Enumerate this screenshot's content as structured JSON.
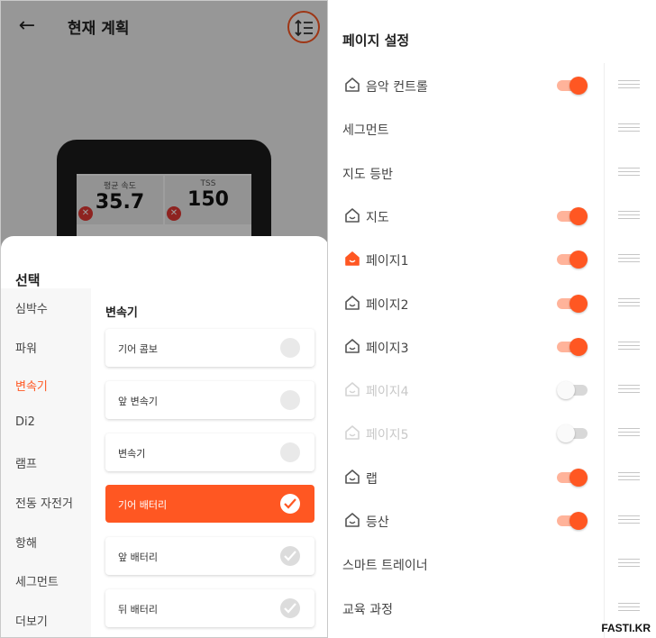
{
  "left": {
    "back_icon": "arrow-left-icon",
    "title": "현재 계획",
    "reorder_icon": "reorder-list-icon",
    "device_metrics": [
      {
        "label": "평균 속도",
        "value": "35.7"
      },
      {
        "label": "TSS",
        "value": "150"
      }
    ],
    "sheet": {
      "title": "선택",
      "categories": [
        "심박수",
        "파워",
        "변속기",
        "Di2",
        "램프",
        "전동 자전거",
        "항해",
        "세그먼트",
        "더보기"
      ],
      "active_category": "변속기",
      "section_title": "변속기",
      "options": [
        {
          "label": "기어 콤보",
          "state": "unchecked"
        },
        {
          "label": "앞 변속기",
          "state": "unchecked"
        },
        {
          "label": "변속기",
          "state": "unchecked"
        },
        {
          "label": "기어 배터리",
          "state": "selected"
        },
        {
          "label": "앞 배터리",
          "state": "checked"
        },
        {
          "label": "뒤 배터리",
          "state": "checked"
        }
      ]
    }
  },
  "right": {
    "title": "페이지 설정",
    "rows": [
      {
        "label": "음악 컨트롤",
        "icon": "home-outline-icon",
        "toggle": "on"
      },
      {
        "label": "세그먼트",
        "icon": "",
        "toggle": "none"
      },
      {
        "label": "지도 등반",
        "icon": "",
        "toggle": "none"
      },
      {
        "label": "지도",
        "icon": "home-outline-icon",
        "toggle": "on"
      },
      {
        "label": "페이지1",
        "icon": "home-filled-icon",
        "toggle": "on"
      },
      {
        "label": "페이지2",
        "icon": "home-outline-icon",
        "toggle": "on"
      },
      {
        "label": "페이지3",
        "icon": "home-outline-icon",
        "toggle": "on"
      },
      {
        "label": "페이지4",
        "icon": "home-outline-icon",
        "toggle": "off"
      },
      {
        "label": "페이지5",
        "icon": "home-outline-icon",
        "toggle": "off"
      },
      {
        "label": "랩",
        "icon": "home-outline-icon",
        "toggle": "on"
      },
      {
        "label": "등산",
        "icon": "home-outline-icon",
        "toggle": "on"
      },
      {
        "label": "스마트 트레이너",
        "icon": "",
        "toggle": "none"
      },
      {
        "label": "교육 과정",
        "icon": "",
        "toggle": "none"
      }
    ]
  },
  "watermark": "FASTI.KR",
  "colors": {
    "accent": "#ff5722",
    "accent_light": "#ffb39a",
    "overlay": "#000000"
  }
}
